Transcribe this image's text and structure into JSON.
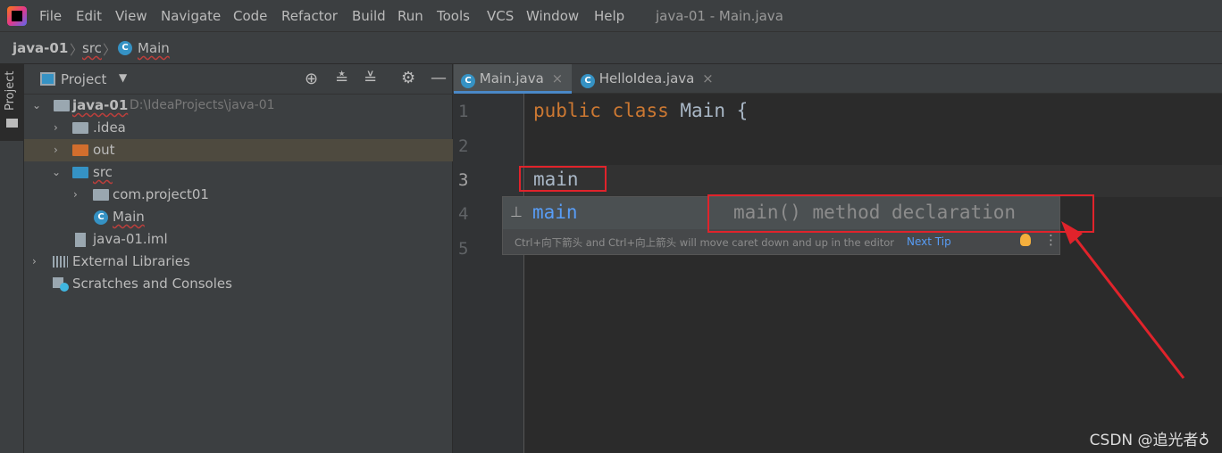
{
  "menubar": {
    "items": [
      "File",
      "Edit",
      "View",
      "Navigate",
      "Code",
      "Refactor",
      "Build",
      "Run",
      "Tools",
      "VCS",
      "Window",
      "Help"
    ],
    "title": "java-01 - Main.java"
  },
  "breadcrumb": [
    "java-01",
    "src",
    "Main"
  ],
  "sidebar": {
    "strip_label": "Project",
    "panel_title": "Project"
  },
  "tree": [
    {
      "label": "java-01",
      "path": "D:\\IdeaProjects\\java-01"
    },
    {
      "label": ".idea"
    },
    {
      "label": "out"
    },
    {
      "label": "src"
    },
    {
      "label": "com.project01"
    },
    {
      "label": "Main"
    },
    {
      "label": "java-01.iml"
    },
    {
      "label": "External Libraries"
    },
    {
      "label": "Scratches and Consoles"
    }
  ],
  "tabs": [
    {
      "label": "Main.java",
      "active": true
    },
    {
      "label": "HelloIdea.java",
      "active": false
    }
  ],
  "editor": {
    "line_numbers": [
      "1",
      "2",
      "3",
      "4",
      "5"
    ],
    "line1": {
      "kw1": "public",
      "kw2": "class",
      "name": "Main {"
    },
    "line3": "main"
  },
  "completion": {
    "item": "main",
    "description": "main() method declaration",
    "hint": "Ctrl+向下箭头 and Ctrl+向上箭头 will move caret down and up in the editor",
    "next_tip": "Next Tip"
  },
  "watermark": "CSDN @追光者♁",
  "colors": {
    "accent": "#4a88c7",
    "annotation": "#e0232b"
  }
}
